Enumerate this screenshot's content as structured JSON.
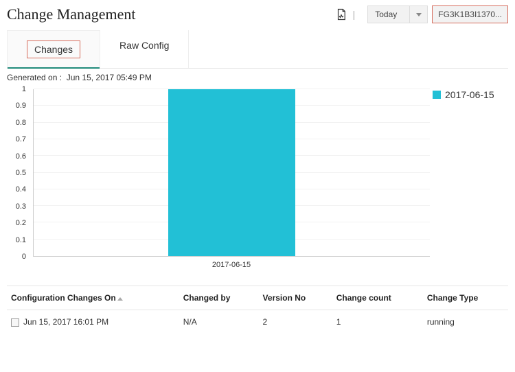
{
  "header": {
    "title": "Change Management",
    "date_dropdown": "Today",
    "device_id": "FG3K1B3I1370..."
  },
  "tabs": [
    {
      "label": "Changes",
      "active": true
    },
    {
      "label": "Raw Config",
      "active": false
    }
  ],
  "generated_label": "Generated on :",
  "generated_value": "Jun 15, 2017 05:49 PM",
  "chart_data": {
    "type": "bar",
    "categories": [
      "2017-06-15"
    ],
    "values": [
      1
    ],
    "title": "",
    "xlabel": "",
    "ylabel": "",
    "ylim": [
      0,
      1
    ],
    "yticks": [
      0,
      0.1,
      0.2,
      0.3,
      0.4,
      0.5,
      0.6,
      0.7,
      0.8,
      0.9,
      1
    ],
    "series": [
      {
        "name": "2017-06-15",
        "color": "#22c0d6",
        "values": [
          1
        ]
      }
    ]
  },
  "table": {
    "columns": [
      "Configuration Changes On",
      "Changed by",
      "Version No",
      "Change count",
      "Change Type"
    ],
    "rows": [
      {
        "changed_on": "Jun 15, 2017 16:01 PM",
        "changed_by": "N/A",
        "version_no": 2,
        "change_count": 1,
        "change_type": "running"
      }
    ]
  }
}
